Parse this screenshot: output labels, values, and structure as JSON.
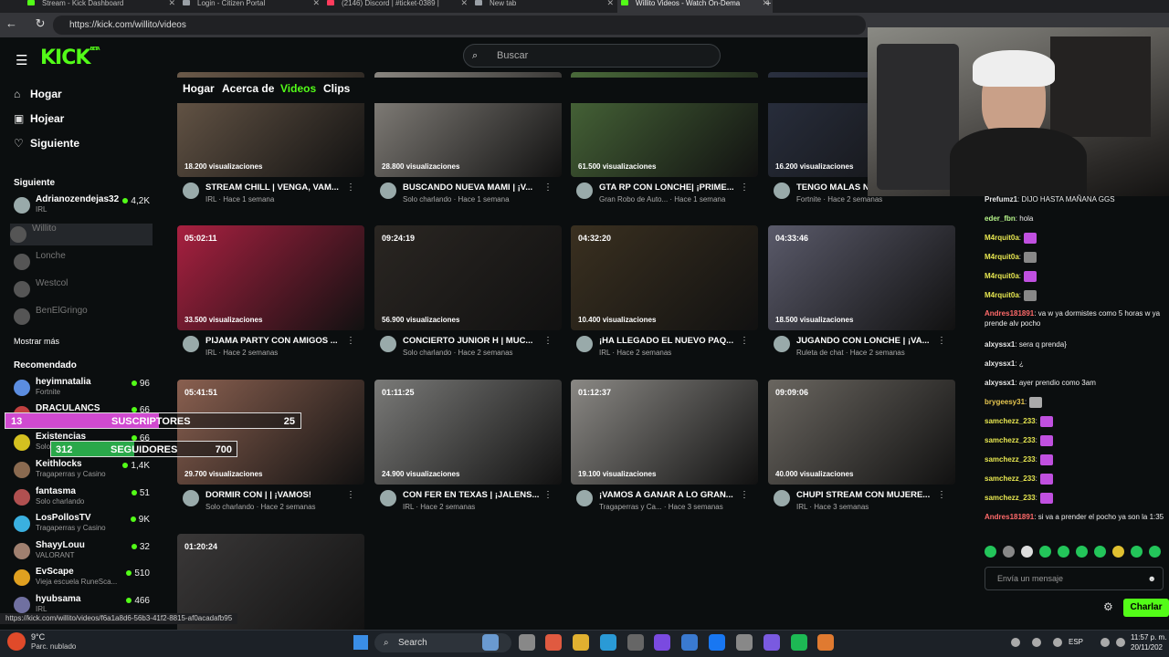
{
  "browser": {
    "tabs": [
      {
        "title": "Stream - Kick Dashboard",
        "fav": "#53fc18",
        "active": false
      },
      {
        "title": "Login - Citizen Portal",
        "fav": "#9aa0a6",
        "active": false
      },
      {
        "title": "(2146) Discord | #ticket-0389 |",
        "fav": "#ff3b5c",
        "active": false
      },
      {
        "title": "New tab",
        "fav": "#9aa0a6",
        "active": false
      },
      {
        "title": "Willito Videos - Watch On-Dema",
        "fav": "#53fc18",
        "active": true
      }
    ],
    "new_tab": "+",
    "url": "https://kick.com/willito/videos",
    "status_url": "https://kick.com/willito/videos/f6a1a8d6-56b3-41f2-8815-af0acadafb95"
  },
  "header": {
    "logo": "KICK",
    "logo_beta": "BETA",
    "search_placeholder": "Buscar"
  },
  "sidebar": {
    "nav": [
      {
        "label": "Hogar",
        "icon": "⌂"
      },
      {
        "label": "Hojear",
        "icon": "▣"
      },
      {
        "label": "Siguiente",
        "icon": "♡"
      }
    ],
    "following_title": "Siguiente",
    "following": [
      {
        "name": "Adrianozendejas32",
        "sub": "IRL",
        "viewers": "4,2K",
        "live": true
      },
      {
        "name": "Willito",
        "sub": "",
        "viewers": "",
        "live": false,
        "selected": true
      },
      {
        "name": "Lonche",
        "sub": "",
        "viewers": "",
        "live": false
      },
      {
        "name": "Westcol",
        "sub": "",
        "viewers": "",
        "live": false
      },
      {
        "name": "BenElGringo",
        "sub": "",
        "viewers": "",
        "live": false
      }
    ],
    "show_more": "Mostrar más",
    "recommended_title": "Recomendado",
    "recommended": [
      {
        "name": "heyimnatalia",
        "sub": "Fortnite",
        "viewers": "96",
        "color": "#5b8de0"
      },
      {
        "name": "DRACULANCS",
        "sub": "",
        "viewers": "66",
        "color": "#c04040"
      },
      {
        "name": "Existencias",
        "sub": "Solo charlando",
        "viewers": "66",
        "color": "#d4c020"
      },
      {
        "name": "Keithlocks",
        "sub": "Tragaperras y Casino",
        "viewers": "1,4K",
        "color": "#8a6a50"
      },
      {
        "name": "fantasma",
        "sub": "Solo charlando",
        "viewers": "51",
        "color": "#b05050"
      },
      {
        "name": "LosPollosTV",
        "sub": "Tragaperras y Casino",
        "viewers": "9K",
        "color": "#3ab0e0"
      },
      {
        "name": "ShayyLouu",
        "sub": "VALORANT",
        "viewers": "32",
        "color": "#a08070"
      },
      {
        "name": "EvScape",
        "sub": "Vieja escuela RuneSca...",
        "viewers": "510",
        "color": "#e0a020"
      },
      {
        "name": "hyubsama",
        "sub": "IRL",
        "viewers": "466",
        "color": "#7070a0"
      }
    ]
  },
  "overlay": {
    "subs_label": "SUSCRIPTORES",
    "subs_current": "13",
    "subs_goal": "25",
    "subs_progress": 0.52,
    "follows_label": "SEGUIDORES",
    "follows_current": "312",
    "follows_goal": "700",
    "follows_progress": 0.45
  },
  "content_tabs": [
    {
      "label": "Hogar",
      "active": false
    },
    {
      "label": "Acerca de",
      "active": false
    },
    {
      "label": "Videos",
      "active": true
    },
    {
      "label": "Clips",
      "active": false
    }
  ],
  "videos": [
    {
      "duration": "",
      "views": "18.200 visualizaciones",
      "title": "STREAM CHILL | VENGA, VAM...",
      "meta": "IRL · Hace 1 semana",
      "bg": "#6b5a4a"
    },
    {
      "duration": "",
      "views": "28.800 visualizaciones",
      "title": "BUSCANDO NUEVA MAMI | ¡V...",
      "meta": "Solo charlando · Hace 1 semana",
      "bg": "#8a8680"
    },
    {
      "duration": "",
      "views": "61.500 visualizaciones",
      "title": "GTA RP CON LONCHE| ¡PRIME...",
      "meta": "Gran Robo de Auto... · Hace 1 semana",
      "bg": "#4a6a3a"
    },
    {
      "duration": "",
      "views": "16.200 visualizaciones",
      "title": "TENGO MALAS N...",
      "meta": "Fortnite · Hace 2 semanas",
      "bg": "#2a3040"
    },
    {
      "duration": "05:02:11",
      "views": "33.500 visualizaciones",
      "title": "PIJAMA PARTY CON AMIGOS ...",
      "meta": "IRL · Hace 2 semanas",
      "bg": "#a82040"
    },
    {
      "duration": "09:24:19",
      "views": "56.900 visualizaciones",
      "title": "CONCIERTO JUNIOR H | MUC...",
      "meta": "Solo charlando · Hace 2 semanas",
      "bg": "#2a2622"
    },
    {
      "duration": "04:32:20",
      "views": "10.400 visualizaciones",
      "title": "¡HA LLEGADO EL NUEVO PAQ...",
      "meta": "IRL · Hace 2 semanas",
      "bg": "#3a3020"
    },
    {
      "duration": "04:33:46",
      "views": "18.500 visualizaciones",
      "title": "JUGANDO CON LONCHE | ¡VA...",
      "meta": "Ruleta de chat · Hace 2 semanas",
      "bg": "#5a5a6a"
    },
    {
      "duration": "05:41:51",
      "views": "29.700 visualizaciones",
      "title": "DORMIR CON | | ¡VAMOS!",
      "meta": "Solo charlando · Hace 2 semanas",
      "bg": "#8a6050"
    },
    {
      "duration": "01:11:25",
      "views": "24.900 visualizaciones",
      "title": "CON FER EN TEXAS | ¡JALENS...",
      "meta": "IRL · Hace 2 semanas",
      "bg": "#7a7a78"
    },
    {
      "duration": "01:12:37",
      "views": "19.100 visualizaciones",
      "title": "¡VAMOS A GANAR A LO GRAN...",
      "meta": "Tragaperras y Ca... · Hace 3 semanas",
      "bg": "#8a8884"
    },
    {
      "duration": "09:09:06",
      "views": "40.000 visualizaciones",
      "title": "CHUPI STREAM CON MUJERE...",
      "meta": "IRL · Hace 3 semanas",
      "bg": "#6a6660"
    },
    {
      "duration": "01:20:24",
      "views": "",
      "title": "",
      "meta": "",
      "bg": "#3a3838"
    }
  ],
  "chat": {
    "messages": [
      {
        "user": "Prefumz1",
        "color": "#e8e8e8",
        "text": ": DIJO HASTA MAÑANA GGS",
        "emotes": []
      },
      {
        "user": "eder_fbn",
        "color": "#b7f58a",
        "text": ": hola",
        "emotes": []
      },
      {
        "user": "M4rquit0a",
        "color": "#e6e650",
        "text": ":",
        "emotes": [
          "#c050e0"
        ]
      },
      {
        "user": "M4rquit0a",
        "color": "#e6e650",
        "text": ":",
        "emotes": [
          "#888888"
        ]
      },
      {
        "user": "M4rquit0a",
        "color": "#e6e650",
        "text": ":",
        "emotes": [
          "#c050e0"
        ]
      },
      {
        "user": "M4rquit0a",
        "color": "#e6e650",
        "text": ":",
        "emotes": [
          "#888888"
        ]
      },
      {
        "user": "Andres181891",
        "color": "#ff6a6a",
        "text": ": va w ya dormistes como 5 horas w ya prende alv pocho",
        "emotes": []
      },
      {
        "user": "alxyssx1",
        "color": "#e8e8e8",
        "text": ": sera q prenda}",
        "emotes": []
      },
      {
        "user": "alxyssx1",
        "color": "#e8e8e8",
        "text": ": ¿",
        "emotes": []
      },
      {
        "user": "alxyssx1",
        "color": "#e8e8e8",
        "text": ": ayer prendio como 3am",
        "emotes": []
      },
      {
        "user": "brygeesy31",
        "color": "#e6c650",
        "text": ":",
        "emotes": [
          "#aaaaaa"
        ]
      },
      {
        "user": "samchezz_233",
        "color": "#e6e650",
        "text": ":",
        "emotes": [
          "#c050e0"
        ]
      },
      {
        "user": "samchezz_233",
        "color": "#e6e650",
        "text": ":",
        "emotes": [
          "#c050e0"
        ]
      },
      {
        "user": "samchezz_233",
        "color": "#e6e650",
        "text": ":",
        "emotes": [
          "#c050e0"
        ]
      },
      {
        "user": "samchezz_233",
        "color": "#e6e650",
        "text": ":",
        "emotes": [
          "#c050e0"
        ]
      },
      {
        "user": "samchezz_233",
        "color": "#e6e650",
        "text": ":",
        "emotes": [
          "#c050e0"
        ]
      },
      {
        "user": "Andres181891",
        "color": "#ff6a6a",
        "text": ": si va a prender el pocho ya son la 1:35",
        "emotes": []
      }
    ],
    "input_placeholder": "Envía un mensaje",
    "send_label": "Charlar"
  },
  "taskbar": {
    "weather_temp": "9°C",
    "weather_desc": "Parc. nublado",
    "search_label": "Search",
    "lang": "ESP",
    "time": "11:57 p. m.",
    "date": "20/11/202"
  },
  "colors": {
    "accent": "#53fc18",
    "bg": "#0b0e0f"
  }
}
